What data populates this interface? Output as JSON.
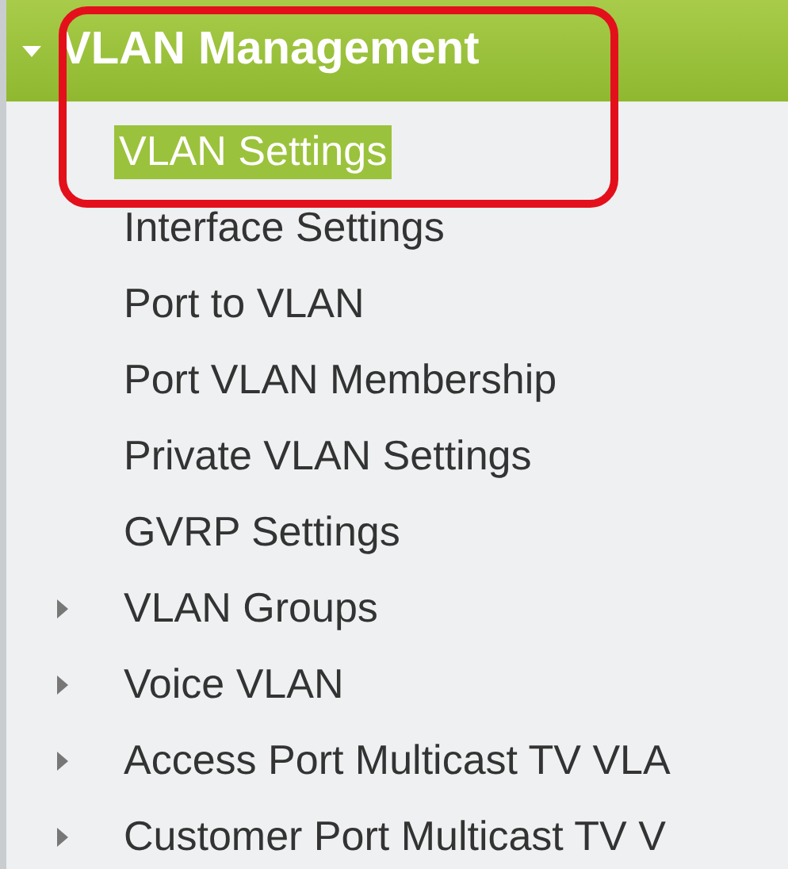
{
  "menu": {
    "title": "VLAN Management",
    "expanded": true,
    "items": [
      {
        "kind": "page",
        "label": "VLAN Settings",
        "selected": true
      },
      {
        "kind": "page",
        "label": "Interface Settings",
        "selected": false
      },
      {
        "kind": "page",
        "label": "Port to VLAN",
        "selected": false
      },
      {
        "kind": "page",
        "label": "Port VLAN Membership",
        "selected": false
      },
      {
        "kind": "page",
        "label": "Private VLAN Settings",
        "selected": false
      },
      {
        "kind": "page",
        "label": "GVRP Settings",
        "selected": false
      },
      {
        "kind": "group",
        "label": "VLAN Groups",
        "selected": false,
        "expanded": false
      },
      {
        "kind": "group",
        "label": "Voice VLAN",
        "selected": false,
        "expanded": false
      },
      {
        "kind": "group",
        "label": "Access Port Multicast TV VLA",
        "selected": false,
        "expanded": false
      },
      {
        "kind": "group",
        "label": "Customer Port Multicast TV V",
        "selected": false,
        "expanded": false
      }
    ]
  }
}
